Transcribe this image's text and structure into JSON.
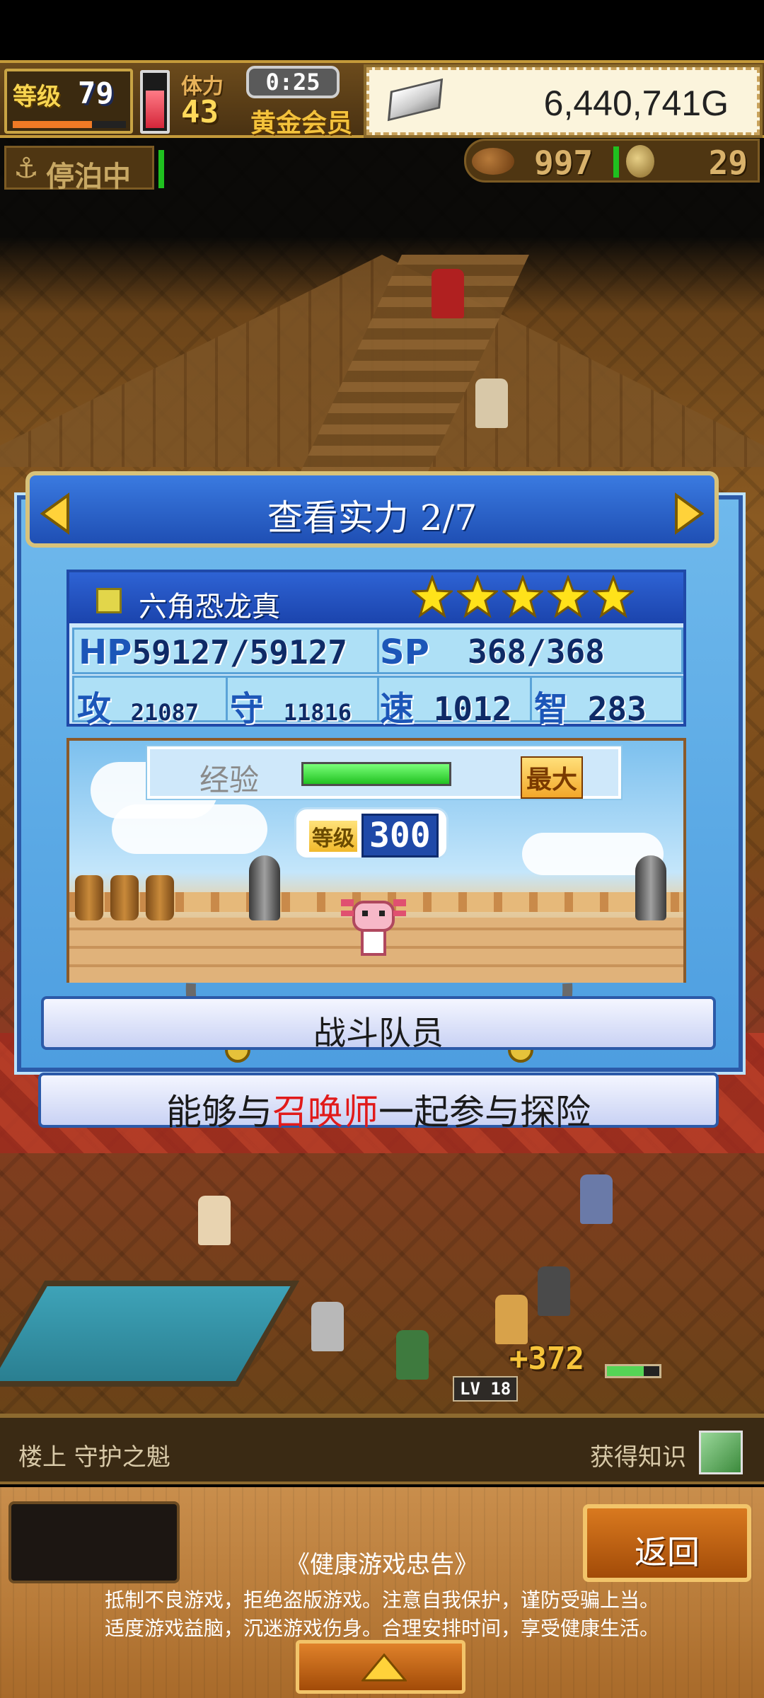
{
  "hud": {
    "level_label": "等级",
    "level_value": "79",
    "level_progress_pct": 70,
    "stamina_gauge_pct": 65,
    "stamina_label": "体力",
    "stamina_value": "43",
    "timer": "0:25",
    "membership": "黄金会员",
    "gold": "6,440,741G"
  },
  "status": {
    "docking": "停泊中",
    "food": "997",
    "coins": "29"
  },
  "dialog": {
    "title": "查看实力 2/7",
    "unit_name": "六角恐龙真",
    "star_count": 5,
    "hp_label": "HP",
    "hp_value": "59127/59127",
    "sp_label": "SP",
    "sp_value": "368/368",
    "atk_label": "攻",
    "atk_value": "21087",
    "def_label": "守",
    "def_value": "11816",
    "spd_label": "速",
    "spd_value": "1012",
    "int_label": "智",
    "int_value": "283",
    "exp_label": "经验",
    "exp_fill_pct": 100,
    "exp_max": "最大",
    "level_label": "等级",
    "level_value": "300",
    "role": "战斗队员",
    "desc_pre": "能够与",
    "desc_highlight": "召唤师",
    "desc_post": "一起参与探险"
  },
  "scene": {
    "float_number": "+372",
    "lv_tag": "LV 18"
  },
  "location": {
    "place": "楼上 守护之魁",
    "knowledge": "获得知识"
  },
  "bottom": {
    "back_label": "返回",
    "health_title": "《健康游戏忠告》",
    "health_line1": "抵制不良游戏，拒绝盗版游戏。注意自我保护，谨防受骗上当。",
    "health_line2": "适度游戏益脑，沉迷游戏伤身。合理安排时间，享受健康生活。"
  },
  "colors": {
    "panel_blue": "#4d9ee0",
    "header_blue": "#1f4fb4",
    "highlight_red": "#e11a1a",
    "exp_green": "#21c221",
    "star_yellow": "#ffe21a"
  },
  "icons": [
    "anchor-icon",
    "food-icon",
    "coin-icon",
    "silver-bar-icon",
    "star-icon",
    "arrow-left-icon",
    "arrow-right-icon",
    "book-icon",
    "arrow-up-icon"
  ]
}
